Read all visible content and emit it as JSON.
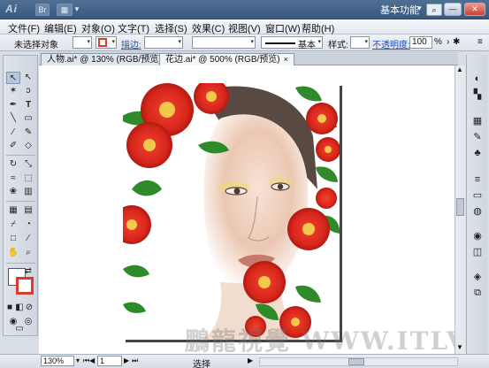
{
  "app": {
    "logo": "Ai",
    "workspace_label": "基本功能",
    "window_buttons": {
      "minimize": "—",
      "restore": "▭",
      "close": "✕"
    }
  },
  "menu": {
    "items": [
      "文件(F)",
      "编辑(E)",
      "对象(O)",
      "文字(T)",
      "选择(S)",
      "效果(C)",
      "视图(V)",
      "窗口(W)",
      "帮助(H)"
    ]
  },
  "control": {
    "selection_status": "未选择对象",
    "stroke_label": "描边:",
    "brush_label": "基本",
    "style_label": "样式:",
    "opacity_label": "不透明度:",
    "opacity_value": "100",
    "opacity_unit": "%"
  },
  "tabs": [
    {
      "label": "人物.ai* @ 130% (RGB/预览)",
      "active": false
    },
    {
      "label": "花边.ai* @ 500% (RGB/预览)",
      "active": true
    }
  ],
  "status": {
    "zoom": "130%",
    "page": "1",
    "tool_status": "选择"
  },
  "watermark": "鵬龍視覺 WWW.ITLVI.NET",
  "colors": {
    "flower": "#d7261b",
    "flower_center": "#f2c94c",
    "leaf": "#2f8a2a",
    "fill_swatch": "#ffffff",
    "stroke_swatch": "#d93b2c"
  }
}
